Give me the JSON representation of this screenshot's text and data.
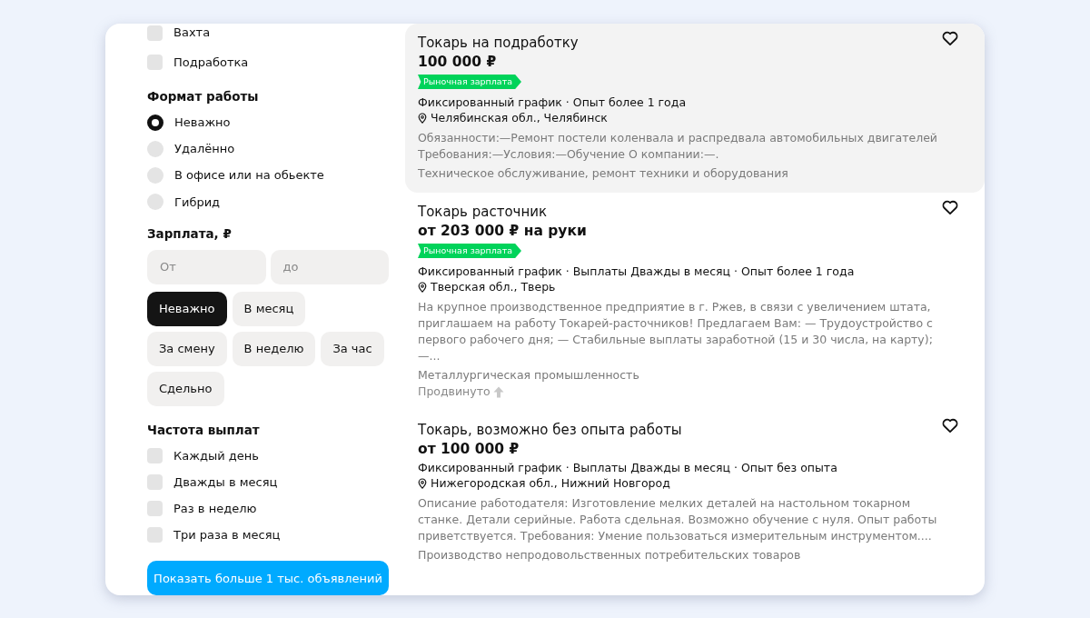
{
  "filters": {
    "employment": [
      {
        "label": "Вахта",
        "checked": false
      },
      {
        "label": "Подработка",
        "checked": false
      }
    ],
    "work_format": {
      "title": "Формат работы",
      "options": [
        {
          "label": "Неважно",
          "selected": true
        },
        {
          "label": "Удалённо",
          "selected": false
        },
        {
          "label": "В офисе или на обьекте",
          "selected": false
        },
        {
          "label": "Гибрид",
          "selected": false
        }
      ]
    },
    "salary": {
      "title": "Зарплата, ₽",
      "from": {
        "placeholder": "От"
      },
      "to": {
        "placeholder": "до"
      },
      "periods": [
        {
          "label": "Неважно",
          "selected": true
        },
        {
          "label": "В месяц",
          "selected": false
        },
        {
          "label": "За смену",
          "selected": false
        },
        {
          "label": "В неделю",
          "selected": false
        },
        {
          "label": "За час",
          "selected": false
        },
        {
          "label": "Сдельно",
          "selected": false
        }
      ]
    },
    "payout_frequency": {
      "title": "Частота выплат",
      "options": [
        {
          "label": "Каждый день",
          "checked": false
        },
        {
          "label": "Дважды в месяц",
          "checked": false
        },
        {
          "label": "Раз в неделю",
          "checked": false
        },
        {
          "label": "Три раза в месяц",
          "checked": false
        }
      ]
    },
    "show_button": "Показать больше 1 тыс. объявлений"
  },
  "vacancies": [
    {
      "title": "Токарь на подработку",
      "salary": "100 000 ₽",
      "badge": "Рыночная зарплата",
      "highlighted": true,
      "conditions": "Фиксированный график · Опыт более 1 года",
      "location": "Челябинская обл., Челябинск",
      "description": "Обязанности:—Ремонт постели коленвала и распредвала автомобильных двигателей Требования:—Условия:—Обучение О компании:—.",
      "industry": "Техническое обслуживание, ремонт техники и оборудования"
    },
    {
      "title": "Токарь расточник",
      "salary": "от 203 000 ₽ на руки",
      "badge": "Рыночная зарплата",
      "highlighted": false,
      "conditions": "Фиксированный график · Выплаты Дважды в месяц · Опыт более 1 года",
      "location": "Тверская обл., Тверь",
      "description": "На крупное производственное предприятие в г. Ржев, в связи с увеличением штата, приглашаем на работу Токарей-расточников! Предлагаем Вам: — Трудоустройство с первого рабочего дня; — Стабильные выплаты заработной (15 и 30 числа, на карту); —...",
      "industry": "Металлургическая промышленность",
      "promoted": "Продвинуто"
    },
    {
      "title": "Токарь, возможно без опыта работы",
      "salary": "от 100 000 ₽",
      "highlighted": false,
      "conditions": "Фиксированный график · Выплаты Дважды в месяц · Опыт без опыта",
      "location": "Нижегородская обл., Нижний Новгород",
      "description": "Описание работодателя: Изготовление мелких деталей на настольном токарном станке. Детали серийные. Работа сдельная. Возможно обучение с нуля. Опыт работы приветствуется. Требования: Умение пользоваться измерительным инструментом....",
      "industry": "Производство непродовольственных потребительских товаров"
    }
  ]
}
